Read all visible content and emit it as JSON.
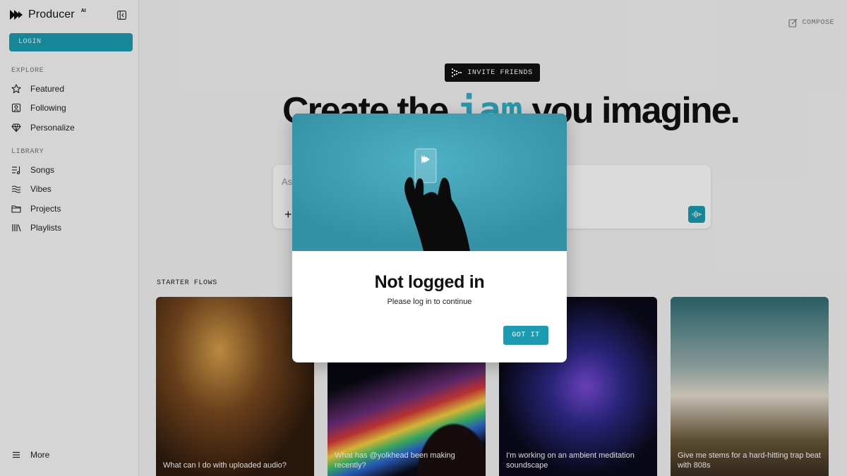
{
  "brand": {
    "name": "Producer",
    "sup": "AI"
  },
  "sidebar": {
    "login_label": "LOGIN",
    "explore_label": "EXPLORE",
    "explore_items": [
      {
        "label": "Featured",
        "icon": "star-icon"
      },
      {
        "label": "Following",
        "icon": "user-frame-icon"
      },
      {
        "label": "Personalize",
        "icon": "diamond-icon"
      }
    ],
    "library_label": "LIBRARY",
    "library_items": [
      {
        "label": "Songs",
        "icon": "music-list-icon"
      },
      {
        "label": "Vibes",
        "icon": "waves-icon"
      },
      {
        "label": "Projects",
        "icon": "folder-icon"
      },
      {
        "label": "Playlists",
        "icon": "library-icon"
      }
    ],
    "more_label": "More"
  },
  "header": {
    "compose_label": "COMPOSE",
    "invite_label": "INVITE FRIENDS"
  },
  "hero": {
    "headline_start": "Create the",
    "headline_word": "jam",
    "headline_end": "you imagine."
  },
  "prompt": {
    "placeholder": "As"
  },
  "starter": {
    "label": "STARTER FLOWS",
    "cards": [
      {
        "caption": "What can I do with uploaded audio?"
      },
      {
        "caption": "What has @yolkhead been making recently?"
      },
      {
        "caption": "I'm working on an ambient meditation soundscape"
      },
      {
        "caption": "Give me stems for a hard-hitting trap beat with 808s"
      }
    ]
  },
  "modal": {
    "title": "Not logged in",
    "subtitle": "Please log in to continue",
    "button_label": "GOT IT"
  },
  "colors": {
    "accent": "#1b9cb2",
    "hero_bg": "#3a9bb0"
  }
}
